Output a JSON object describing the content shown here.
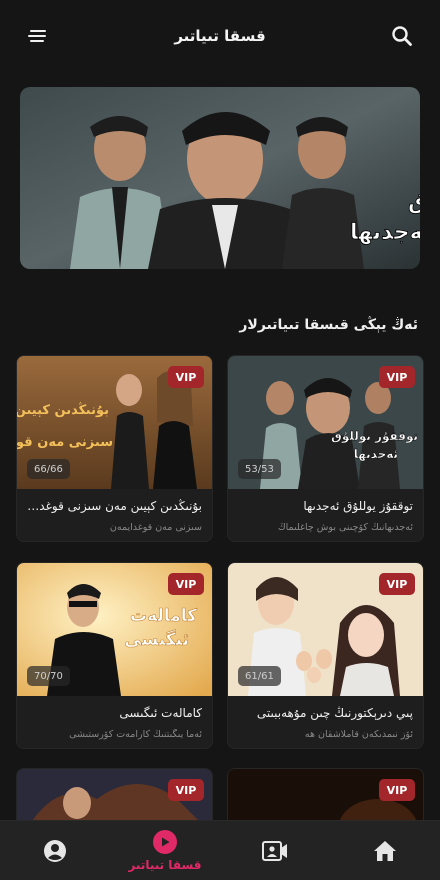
{
  "header": {
    "title": "قسقا تىياتىر",
    "menu_icon": "menu-icon",
    "search_icon": "search-icon"
  },
  "banner": {
    "title_line1": "توققۇز يوللۇق",
    "title_line2": "ئەجدىھا"
  },
  "section": {
    "title": "ئەڭ يېڭى قىسقا تىياتىرلار"
  },
  "cards": [
    {
      "title": "توققۇز يوللۇق ئەجدىھا",
      "desc": "ئەجدىھانىڭ كۆچىنى بوش چاغلىماڭ",
      "episodes": "53/53",
      "badge": "VIP",
      "poster_text": [
        "توققۇز يوللۇق",
        "ئەجدىھا"
      ]
    },
    {
      "title": "بۇنىڭدىن كېيىن مەن سىزنى قوغدا...",
      "desc": "سىزنى مەن قوغدايمەن",
      "episodes": "66/66",
      "badge": "VIP",
      "poster_text": [
        "بۇنىڭدىن كېيىن",
        "سىزنى مەن قوغدا"
      ]
    },
    {
      "title": "پىي دىرېكتورنىڭ چىن مۇھەببىتى",
      "desc": "ئۆز نىمدىكەن قاملاشقان ھە",
      "episodes": "61/61",
      "badge": "VIP",
      "poster_text": []
    },
    {
      "title": "كامالەت ئىگىسى",
      "desc": "ئەما يىگىتنىڭ كارامەت كۆرستىشى",
      "episodes": "70/70",
      "badge": "VIP",
      "poster_text": [
        "كامالەت",
        "ئىگىسى"
      ]
    },
    {
      "title": "",
      "desc": "",
      "episodes": "",
      "badge": "VIP",
      "poster_text": []
    },
    {
      "title": "",
      "desc": "",
      "episodes": "",
      "badge": "VIP",
      "poster_text": []
    }
  ],
  "bottom_nav": [
    {
      "icon": "profile-icon",
      "label": ""
    },
    {
      "icon": "play-circle-icon",
      "label": "قسقا تىياتىر",
      "active": true
    },
    {
      "icon": "video-camera-icon",
      "label": ""
    },
    {
      "icon": "home-icon",
      "label": ""
    }
  ],
  "colors": {
    "background": "#151515",
    "card": "#1e1e1e",
    "vip": "#a3262a",
    "accent": "#e02a67",
    "nav": "#232323"
  }
}
